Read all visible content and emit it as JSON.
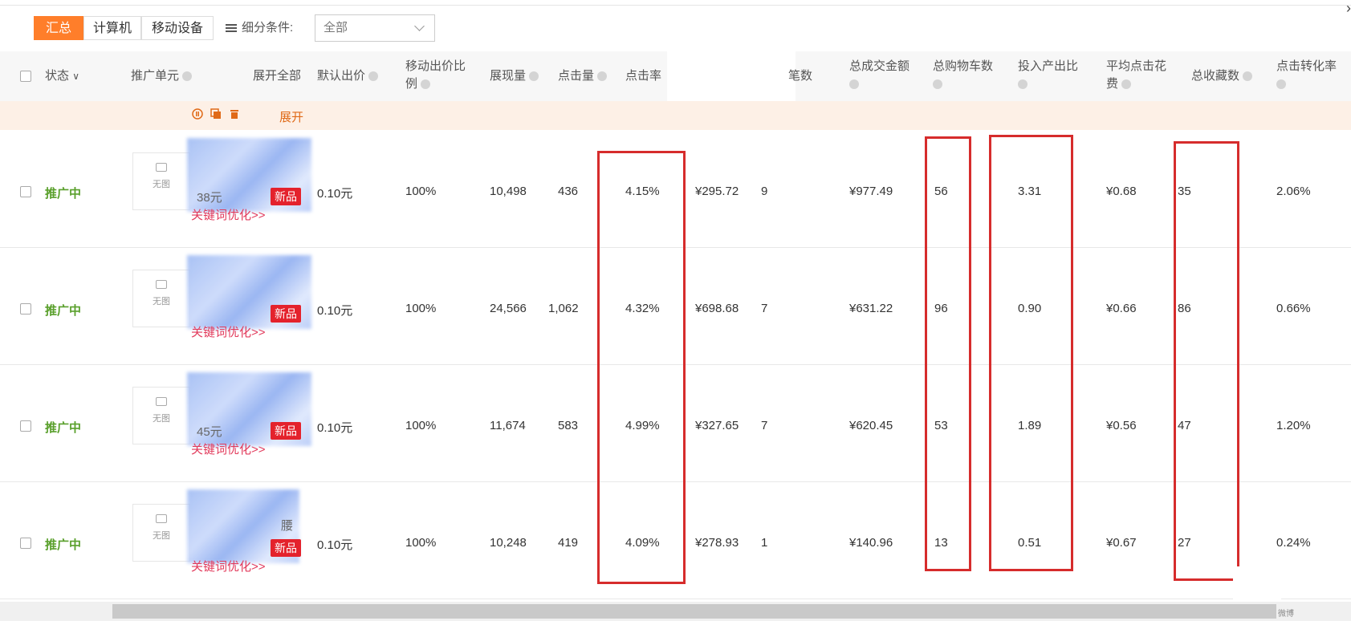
{
  "filter": {
    "tabs": [
      {
        "label": "汇总",
        "active": true
      },
      {
        "label": "计算机",
        "active": false
      },
      {
        "label": "移动设备",
        "active": false
      }
    ],
    "condition_label": "细分条件:",
    "select_value": "全部"
  },
  "header": {
    "status": "状态",
    "unit": "推广单元",
    "expand_all": "展开全部",
    "default_bid": "默认出价",
    "mobile_ratio_1": "移动出价比",
    "mobile_ratio_2": "例",
    "impressions": "展现量",
    "clicks": "点击量",
    "ctr": "点击率",
    "deals_partial": "笔数",
    "total_gmv": "总成交金额",
    "cart": "总购物车数",
    "roi": "投入产出比",
    "avg_cpc_1": "平均点击花",
    "avg_cpc_2": "费",
    "favorites": "总收藏数",
    "cvr": "点击转化率"
  },
  "strip": {
    "expand": "展开"
  },
  "row_common": {
    "status": "推广中",
    "no_image": "无图",
    "badge": "新品",
    "bid": "0.10元",
    "ratio": "100%",
    "keyword_link": "关键词优化>>"
  },
  "rows": [
    {
      "name_frag": "38元",
      "impressions": "10,498",
      "clicks": "436",
      "ctr": "4.15%",
      "cost": "¥295.72",
      "deals": "9",
      "gmv": "¥977.49",
      "cart": "56",
      "roi": "3.31",
      "cpc": "¥0.68",
      "fav": "35",
      "cvr": "2.06%"
    },
    {
      "name_frag": "",
      "impressions": "24,566",
      "clicks": "1,062",
      "ctr": "4.32%",
      "cost": "¥698.68",
      "deals": "7",
      "gmv": "¥631.22",
      "cart": "96",
      "roi": "0.90",
      "cpc": "¥0.66",
      "fav": "86",
      "cvr": "0.66%"
    },
    {
      "name_frag": "45元",
      "impressions": "11,674",
      "clicks": "583",
      "ctr": "4.99%",
      "cost": "¥327.65",
      "deals": "7",
      "gmv": "¥620.45",
      "cart": "53",
      "roi": "1.89",
      "cpc": "¥0.56",
      "fav": "47",
      "cvr": "1.20%"
    },
    {
      "name_frag": "腰",
      "impressions": "10,248",
      "clicks": "419",
      "ctr": "4.09%",
      "cost": "¥278.93",
      "deals": "1",
      "gmv": "¥140.96",
      "cart": "13",
      "roi": "0.51",
      "cpc": "¥0.67",
      "fav": "27",
      "cvr": "0.24%"
    }
  ],
  "watermark": "微博",
  "colors": {
    "accent": "#ff7e2a",
    "status": "#5aa02c",
    "badge": "#e4222c",
    "annotation": "#d62c2c"
  }
}
